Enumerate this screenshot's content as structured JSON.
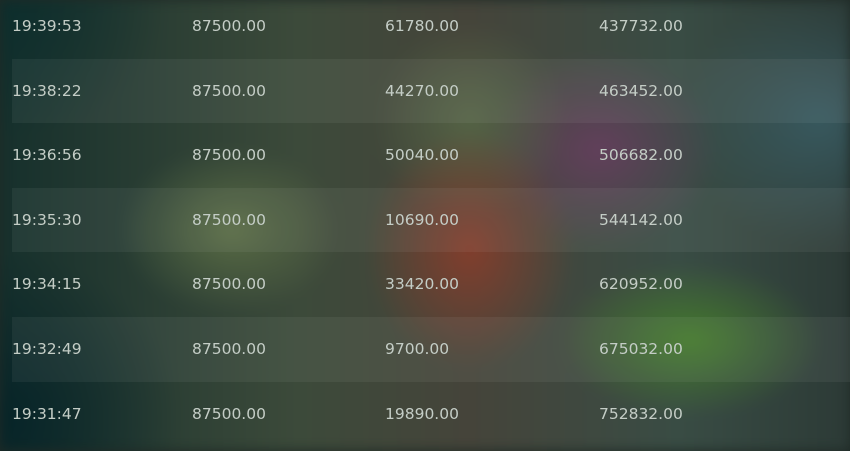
{
  "table": {
    "rows": [
      {
        "time": "19:39:53",
        "col2": "87500.00",
        "col3": "61780.00",
        "col4": "437732.00"
      },
      {
        "time": "19:38:22",
        "col2": "87500.00",
        "col3": "44270.00",
        "col4": "463452.00"
      },
      {
        "time": "19:36:56",
        "col2": "87500.00",
        "col3": "50040.00",
        "col4": "506682.00"
      },
      {
        "time": "19:35:30",
        "col2": "87500.00",
        "col3": "10690.00",
        "col4": "544142.00"
      },
      {
        "time": "19:34:15",
        "col2": "87500.00",
        "col3": "33420.00",
        "col4": "620952.00"
      },
      {
        "time": "19:32:49",
        "col2": "87500.00",
        "col3": "9700.00",
        "col4": "675032.00"
      },
      {
        "time": "19:31:47",
        "col2": "87500.00",
        "col3": "19890.00",
        "col4": "752832.00"
      }
    ]
  }
}
